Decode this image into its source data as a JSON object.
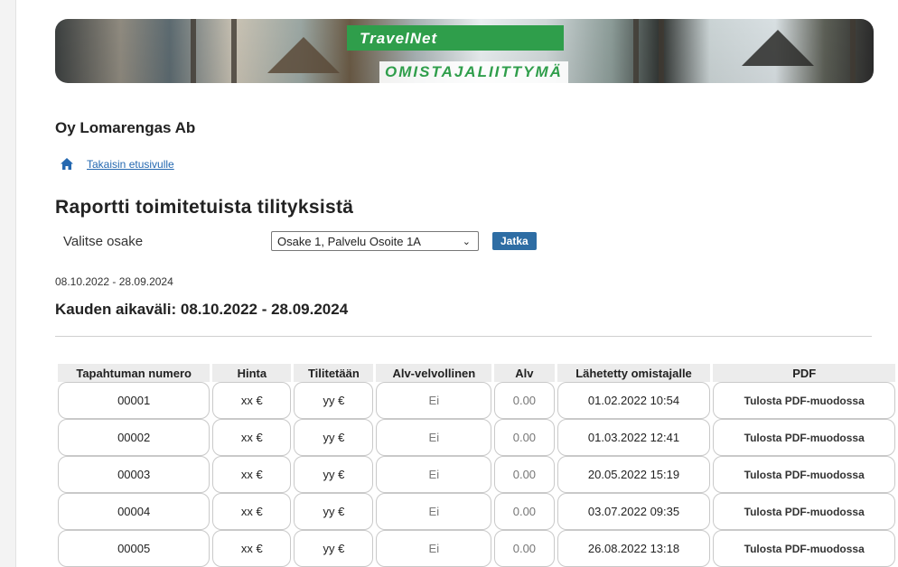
{
  "header": {
    "brand_top": "TravelNet",
    "brand_bottom": "OMISTAJALIITTYMÄ"
  },
  "company": "Oy Lomarengas Ab",
  "home_link": {
    "icon": "home-icon",
    "label": "Takaisin etusivulle"
  },
  "report": {
    "title": "Raportti toimitetuista tilityksistä",
    "select_label": "Valitse osake",
    "select_value": "Osake 1, Palvelu Osoite 1A",
    "continue_label": "Jatka",
    "range_small": "08.10.2022 - 28.09.2024",
    "range_big": "Kauden aikaväli: 08.10.2022 - 28.09.2024"
  },
  "table": {
    "headers": [
      "Tapahtuman numero",
      "Hinta",
      "Tilitetään",
      "Alv-velvollinen",
      "Alv",
      "Lähetetty omistajalle",
      "PDF"
    ],
    "rows": [
      {
        "num": "00001",
        "price": "xx €",
        "settled": "yy €",
        "vat_liable": "Ei",
        "vat": "0.00",
        "sent": "01.02.2022 10:54",
        "pdf": "Tulosta PDF-muodossa"
      },
      {
        "num": "00002",
        "price": "xx €",
        "settled": "yy €",
        "vat_liable": "Ei",
        "vat": "0.00",
        "sent": "01.03.2022 12:41",
        "pdf": "Tulosta PDF-muodossa"
      },
      {
        "num": "00003",
        "price": "xx €",
        "settled": "yy €",
        "vat_liable": "Ei",
        "vat": "0.00",
        "sent": "20.05.2022 15:19",
        "pdf": "Tulosta PDF-muodossa"
      },
      {
        "num": "00004",
        "price": "xx €",
        "settled": "yy €",
        "vat_liable": "Ei",
        "vat": "0.00",
        "sent": "03.07.2022 09:35",
        "pdf": "Tulosta PDF-muodossa"
      },
      {
        "num": "00005",
        "price": "xx €",
        "settled": "yy €",
        "vat_liable": "Ei",
        "vat": "0.00",
        "sent": "26.08.2022 13:18",
        "pdf": "Tulosta PDF-muodossa"
      }
    ]
  },
  "colors": {
    "brand_green": "#2f9e4b",
    "button_blue": "#2e6da4",
    "link_blue": "#2468b0"
  }
}
